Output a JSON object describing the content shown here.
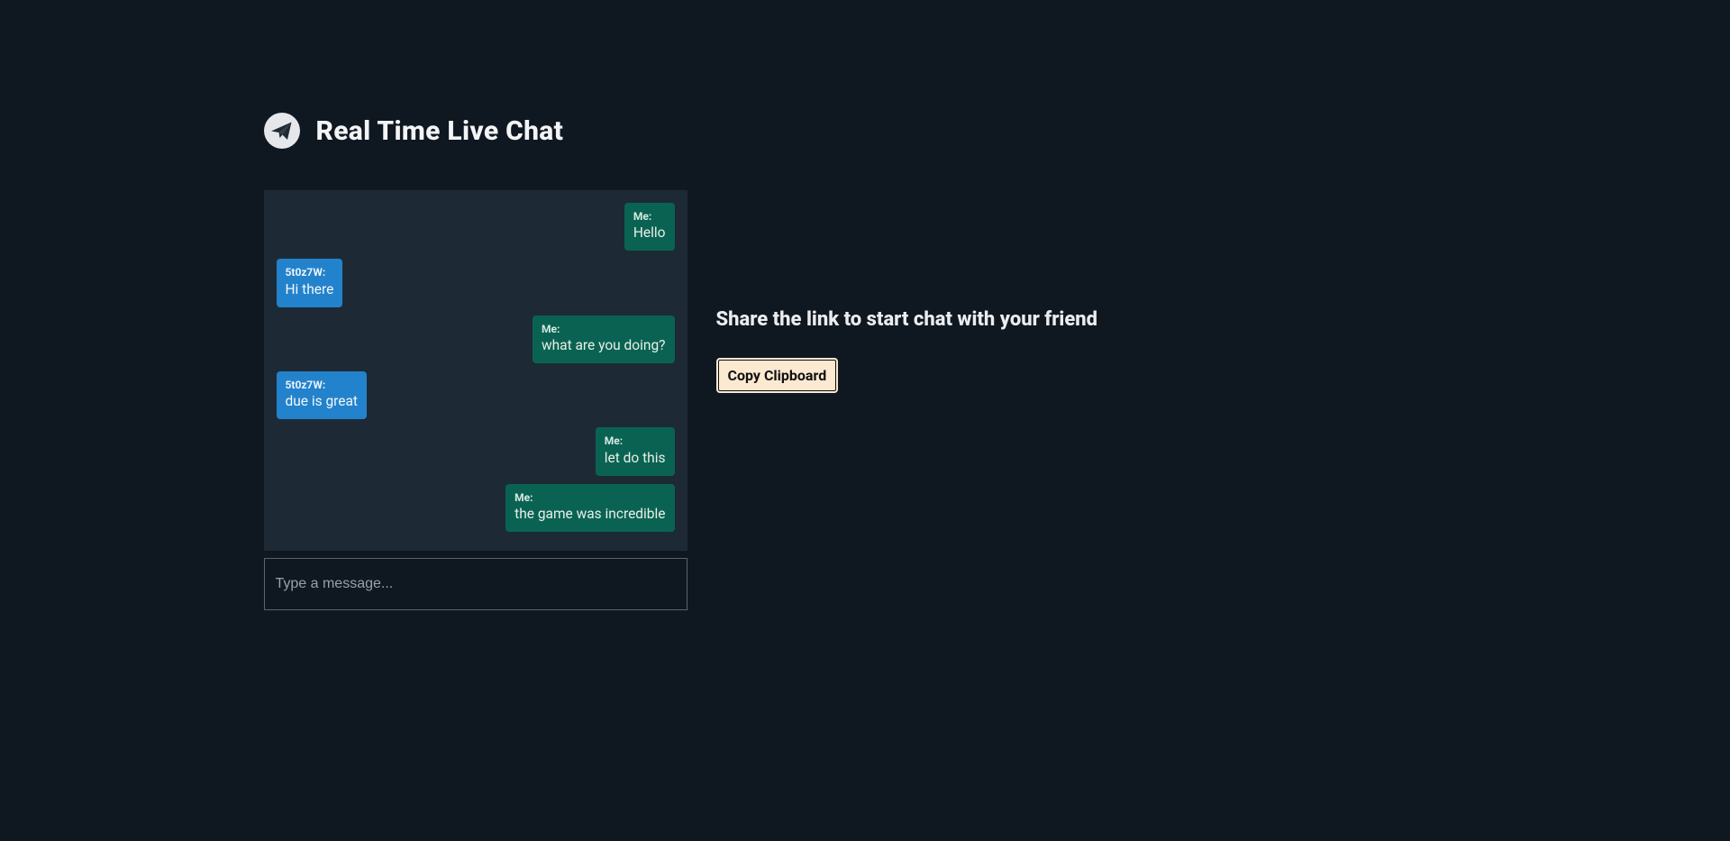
{
  "header": {
    "title": "Real Time Live Chat"
  },
  "messages": [
    {
      "side": "mine",
      "sender": "Me:",
      "text": "Hello"
    },
    {
      "side": "theirs",
      "sender": "5t0z7W:",
      "text": "Hi there"
    },
    {
      "side": "mine",
      "sender": "Me:",
      "text": "what are you doing?"
    },
    {
      "side": "theirs",
      "sender": "5t0z7W:",
      "text": "due is great"
    },
    {
      "side": "mine",
      "sender": "Me:",
      "text": "let do this"
    },
    {
      "side": "mine",
      "sender": "Me:",
      "text": "the game was incredible"
    }
  ],
  "input": {
    "placeholder": "Type a message..."
  },
  "share": {
    "heading": "Share the link to start chat with your friend",
    "button_label": "Copy Clipboard"
  },
  "colors": {
    "page_bg": "#0f1721",
    "chat_bg": "#1d2a35",
    "mine_bubble": "#0a6352",
    "theirs_bubble": "#2382cc",
    "button_bg": "#fce9d2"
  }
}
